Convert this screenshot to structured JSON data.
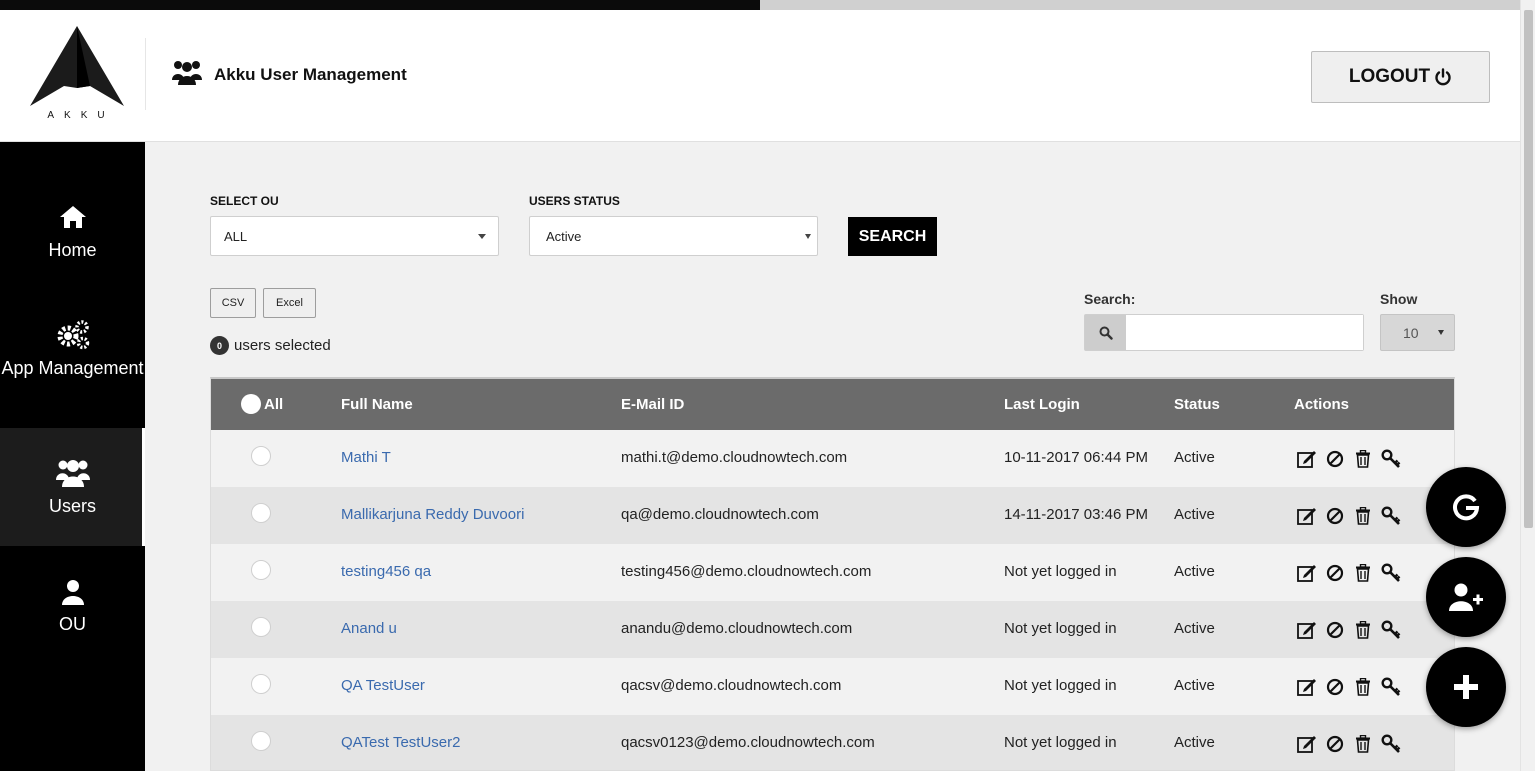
{
  "page_progress": 0.5,
  "header": {
    "logo_text": "AKKU",
    "app_title": "Akku User Management",
    "logout_label": "LOGOUT"
  },
  "sidebar": {
    "items": [
      {
        "label": "Home",
        "icon": "home-icon"
      },
      {
        "label": "App Management",
        "icon": "gears-icon"
      },
      {
        "label": "Users",
        "icon": "users-icon",
        "active": true
      },
      {
        "label": "OU",
        "icon": "user-icon"
      }
    ]
  },
  "filters": {
    "ou_label": "SELECT OU",
    "ou_value": "ALL",
    "status_label": "USERS STATUS",
    "status_value": "Active",
    "search_button": "SEARCH"
  },
  "export": {
    "csv": "CSV",
    "excel": "Excel"
  },
  "selection": {
    "count": "0",
    "text": "users selected"
  },
  "table_search": {
    "label": "Search:",
    "value": ""
  },
  "page_size": {
    "label": "Show",
    "value": "10"
  },
  "table": {
    "select_all": "All",
    "columns": [
      "Full Name",
      "E-Mail ID",
      "Last Login",
      "Status",
      "Actions"
    ],
    "rows": [
      {
        "name": "Mathi T",
        "email": "mathi.t@demo.cloudnowtech.com",
        "last_login": "10-11-2017 06:44 PM",
        "status": "Active"
      },
      {
        "name": "Mallikarjuna Reddy Duvoori",
        "email": "qa@demo.cloudnowtech.com",
        "last_login": "14-11-2017 03:46 PM",
        "status": "Active"
      },
      {
        "name": "testing456 qa",
        "email": "testing456@demo.cloudnowtech.com",
        "last_login": "Not yet logged in",
        "status": "Active"
      },
      {
        "name": "Anand u",
        "email": "anandu@demo.cloudnowtech.com",
        "last_login": "Not yet logged in",
        "status": "Active"
      },
      {
        "name": "QA TestUser",
        "email": "qacsv@demo.cloudnowtech.com",
        "last_login": "Not yet logged in",
        "status": "Active"
      },
      {
        "name": "QATest TestUser2",
        "email": "qacsv0123@demo.cloudnowtech.com",
        "last_login": "Not yet logged in",
        "status": "Active"
      }
    ],
    "row_actions": [
      "edit-icon",
      "disable-icon",
      "trash-icon",
      "key-icon"
    ]
  },
  "fabs": [
    {
      "icon": "google-icon",
      "label": "G"
    },
    {
      "icon": "add-user-icon"
    },
    {
      "icon": "plus-icon"
    }
  ]
}
